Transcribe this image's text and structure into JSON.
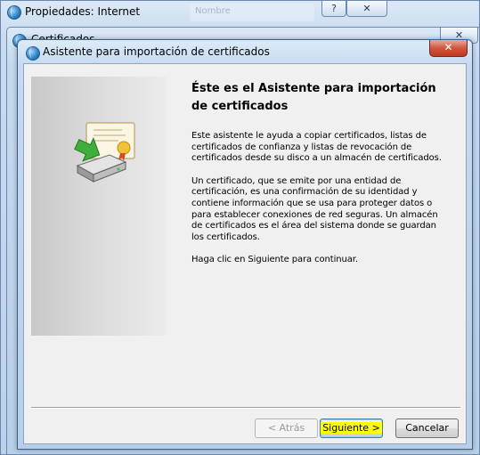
{
  "background_window": {
    "title": "Propiedades: Internet",
    "ghost_tab": "Nombre",
    "help_button": "?",
    "close_button": "✕"
  },
  "middle_window": {
    "title": "Certificados",
    "close_button": "✕"
  },
  "wizard": {
    "title": "Asistente para importación de certificados",
    "close_button": "✕",
    "heading": "Éste es el Asistente para importación de certificados",
    "paragraphs": [
      "Este asistente le ayuda a copiar certificados, listas de certificados de confianza y listas de revocación de certificados desde su disco a un almacén de certificados.",
      "Un certificado, que se emite por una entidad de certificación, es una confirmación de su identidad y contiene información que se usa para proteger datos o para establecer conexiones de red seguras. Un almacén de certificados es el área del sistema donde se guardan los certificados.",
      "Haga clic en Siguiente para continuar."
    ],
    "buttons": {
      "back": "< Atrás",
      "next": "Siguiente >",
      "cancel": "Cancelar"
    },
    "icons": {
      "illustration": "certificate-import-icon"
    }
  }
}
